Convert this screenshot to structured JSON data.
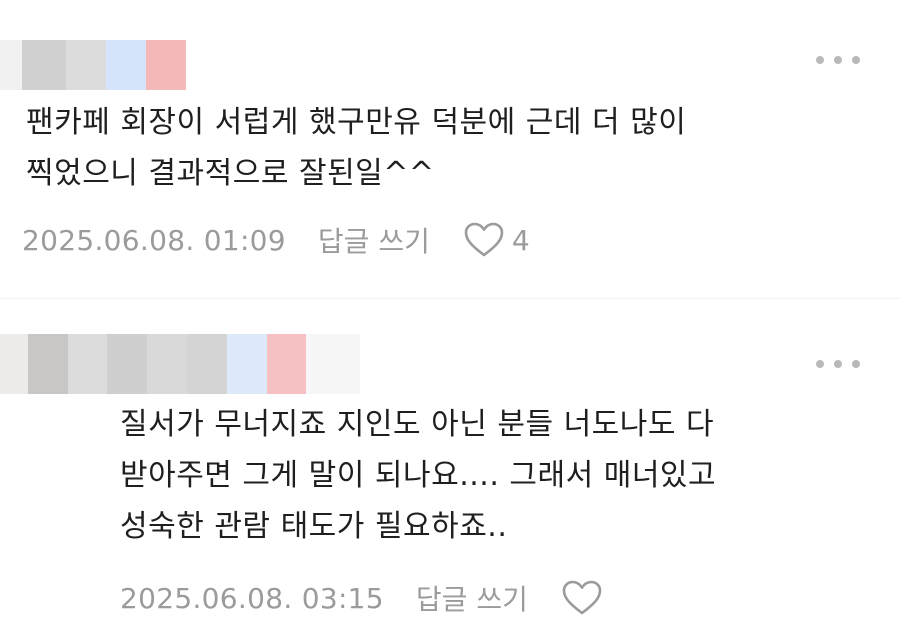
{
  "comments": [
    {
      "body_lines": [
        "팬카페 회장이 서럽게 했구만유 덕분에 근데 더 많이",
        "찍었으니 결과적으로 잘된일^^"
      ],
      "timestamp": "2025.06.08. 01:09",
      "reply_label": "답글 쓰기",
      "like_count": "4",
      "like_icon": "heart-outline-icon",
      "more_icon": "more-dots-icon"
    },
    {
      "body_lines": [
        "질서가 무너지죠 지인도 아닌 분들 너도나도 다",
        "받아주면 그게 말이 되나요.... 그래서 매너있고",
        "성숙한 관람 태도가 필요하죠.."
      ],
      "timestamp": "2025.06.08. 03:15",
      "reply_label": "답글 쓰기",
      "like_icon": "heart-outline-icon",
      "more_icon": "more-dots-icon"
    }
  ],
  "colors": {
    "body_text": "#1f1f1f",
    "meta_text": "#9b9b9b",
    "icon_gray": "#b9b9b9",
    "background": "#ffffff"
  }
}
